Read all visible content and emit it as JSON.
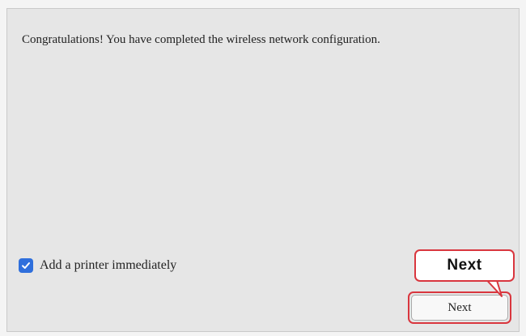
{
  "dialog": {
    "message": "Congratulations!  You have completed the wireless network configuration.",
    "add_printer_checkbox": {
      "label": "Add a printer immediately",
      "checked": true
    },
    "next_button_label": "Next"
  },
  "callout": {
    "text": "Next"
  },
  "colors": {
    "accent": "#2f6fdc",
    "highlight": "#d9363e",
    "dialog_background": "#e6e6e6"
  },
  "icons": {
    "checkbox": "checkmark-icon"
  }
}
